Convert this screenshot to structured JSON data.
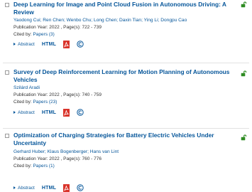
{
  "results": [
    {
      "title": "Deep Learning for Image and Point Cloud Fusion in Autonomous Driving: A Review",
      "authors": "Yaodong Cui; Ren Chen; Wenbo Chu; Long Chen; Daxin Tian; Ying Li; Dongpu Cao",
      "publication": "Publication Year: 2022 , Page(s): 722 - 739",
      "cited_prefix": "Cited by: ",
      "cited_link": "Papers (3)",
      "abstract_label": "Abstract",
      "html_label": "HTML"
    },
    {
      "title": "Survey of Deep Reinforcement Learning for Motion Planning of Autonomous Vehicles",
      "authors": "Szilárd Aradi",
      "publication": "Publication Year: 2022 , Page(s): 740 - 759",
      "cited_prefix": "Cited by: ",
      "cited_link": "Papers (23)",
      "abstract_label": "Abstract",
      "html_label": "HTML"
    },
    {
      "title": "Optimization of Charging Strategies for Battery Electric Vehicles Under Uncertainty",
      "authors": "Gerhard Huber; Klaus Bogenberger; Hans van Lint",
      "publication": "Publication Year: 2022 , Page(s): 760 - 776",
      "cited_prefix": "Cited by: ",
      "cited_link": "Papers (1)",
      "abstract_label": "Abstract",
      "html_label": "HTML"
    }
  ],
  "icons": {
    "lock": "open-access-lock-icon",
    "pdf": "pdf-icon",
    "copyright": "copyright-icon"
  },
  "colors": {
    "link": "#06569a",
    "lock": "#2e8b22",
    "pdf": "#d9342b",
    "text": "#333333"
  }
}
